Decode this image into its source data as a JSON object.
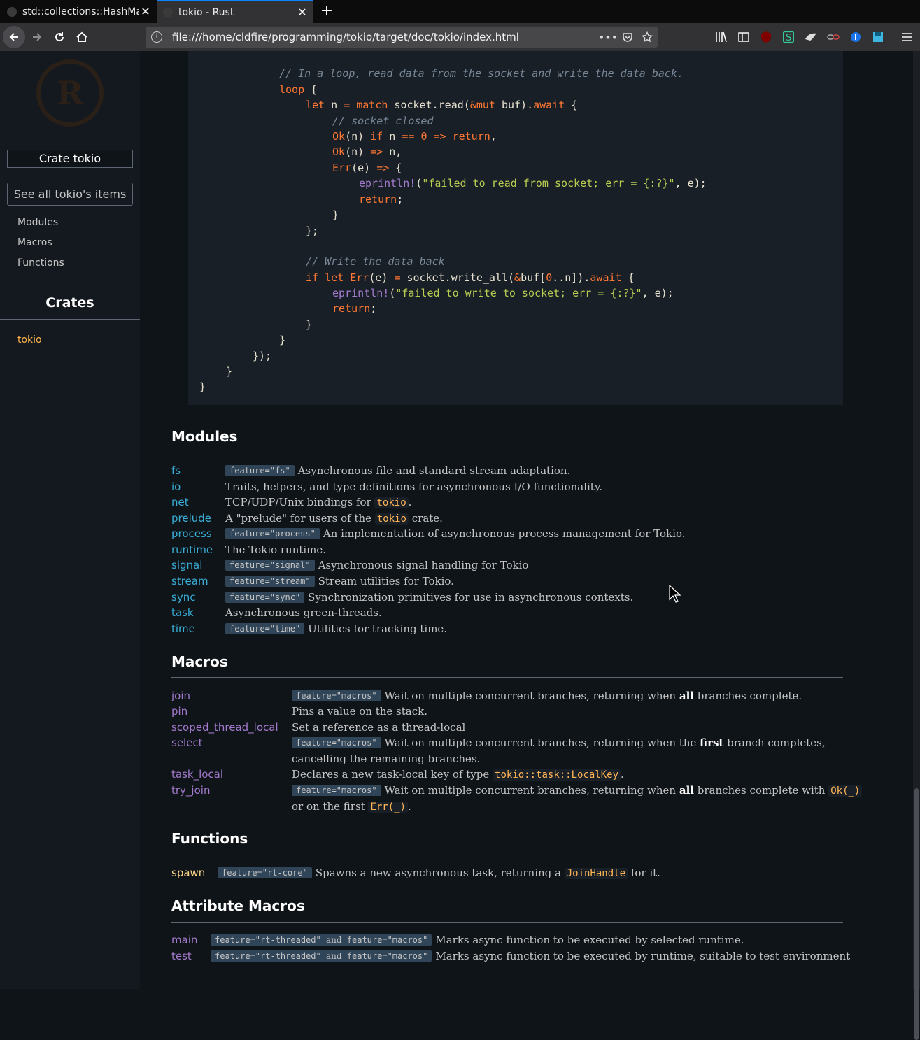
{
  "browser": {
    "tabs": [
      {
        "title": "std::collections::HashMap"
      },
      {
        "title": "tokio - Rust"
      }
    ],
    "url": "file:///home/cldfire/programming/tokio/target/doc/tokio/index.html"
  },
  "sidebar": {
    "crate_label": "Crate tokio",
    "all_items_label": "See all tokio's items",
    "links": [
      "Modules",
      "Macros",
      "Functions"
    ],
    "crates_heading": "Crates",
    "crates": [
      "tokio"
    ]
  },
  "code": {
    "lines": [
      "// In a loop, read data from the socket and write the data back.",
      "loop {",
      "let n = match socket.read(&mut buf).await {",
      "// socket closed",
      "Ok(n) if n == 0 => return,",
      "Ok(n) => n,",
      "Err(e) => {",
      "eprintln!(\"failed to read from socket; err = {:?}\", e);",
      "return;",
      "}",
      "};",
      "// Write the data back",
      "if let Err(e) = socket.write_all(&buf[0..n]).await {",
      "eprintln!(\"failed to write to socket; err = {:?}\", e);",
      "return;",
      "}",
      "}",
      "});",
      "}",
      "}"
    ]
  },
  "modules": {
    "heading": "Modules",
    "items": [
      {
        "name": "fs",
        "feature": "feature=\"fs\"",
        "desc": "Asynchronous file and standard stream adaptation."
      },
      {
        "name": "io",
        "feature": "",
        "desc": "Traits, helpers, and type definitions for asynchronous I/O functionality."
      },
      {
        "name": "net",
        "feature": "",
        "desc_pre": "TCP/UDP/Unix bindings for ",
        "desc_code": "tokio",
        "desc_post": "."
      },
      {
        "name": "prelude",
        "feature": "",
        "desc_pre": "A \"prelude\" for users of the ",
        "desc_code": "tokio",
        "desc_post": " crate."
      },
      {
        "name": "process",
        "feature": "feature=\"process\"",
        "desc": "An implementation of asynchronous process management for Tokio."
      },
      {
        "name": "runtime",
        "feature": "",
        "desc": "The Tokio runtime."
      },
      {
        "name": "signal",
        "feature": "feature=\"signal\"",
        "desc": "Asynchronous signal handling for Tokio"
      },
      {
        "name": "stream",
        "feature": "feature=\"stream\"",
        "desc": "Stream utilities for Tokio."
      },
      {
        "name": "sync",
        "feature": "feature=\"sync\"",
        "desc": "Synchronization primitives for use in asynchronous contexts."
      },
      {
        "name": "task",
        "feature": "",
        "desc": "Asynchronous green-threads."
      },
      {
        "name": "time",
        "feature": "feature=\"time\"",
        "desc": "Utilities for tracking time."
      }
    ]
  },
  "macros": {
    "heading": "Macros",
    "items": [
      {
        "name": "join",
        "feature": "feature=\"macros\"",
        "desc_pre": "Wait on multiple concurrent branches, returning when ",
        "desc_bold": "all",
        "desc_post": " branches complete."
      },
      {
        "name": "pin",
        "desc": "Pins a value on the stack."
      },
      {
        "name": "scoped_thread_local",
        "desc": "Set a reference as a thread-local"
      },
      {
        "name": "select",
        "feature": "feature=\"macros\"",
        "desc_pre": "Wait on multiple concurrent branches, returning when the ",
        "desc_bold": "first",
        "desc_post": " branch completes,",
        "desc_line2": "cancelling the remaining branches."
      },
      {
        "name": "task_local",
        "desc_pre": "Declares a new task-local key of type ",
        "desc_code": "tokio::task::LocalKey",
        "desc_post": "."
      },
      {
        "name": "try_join",
        "feature": "feature=\"macros\"",
        "desc_pre": "Wait on multiple concurrent branches, returning when ",
        "desc_bold": "all",
        "desc_post": " branches complete with ",
        "desc_code": "Ok(_)",
        "desc_line2_pre": "or on the first ",
        "desc_line2_code": "Err(_)",
        "desc_line2_post": "."
      }
    ]
  },
  "functions": {
    "heading": "Functions",
    "items": [
      {
        "name": "spawn",
        "feature": "feature=\"rt-core\"",
        "desc_pre": "Spawns a new asynchronous task, returning a ",
        "desc_code": "JoinHandle",
        "desc_post": " for it."
      }
    ]
  },
  "attribute_macros": {
    "heading": "Attribute Macros",
    "items": [
      {
        "name": "main",
        "feature_a": "feature=\"rt-threaded\"",
        "and": "and",
        "feature_b": "feature=\"macros\"",
        "desc": "Marks async function to be executed by selected runtime."
      },
      {
        "name": "test",
        "feature_a": "feature=\"rt-threaded\"",
        "and": "and",
        "feature_b": "feature=\"macros\"",
        "desc": "Marks async function to be executed by runtime, suitable to test environment"
      }
    ]
  },
  "colors": {
    "background": "#0f1419",
    "sidebar": "#14191f",
    "module_link": "#39afd7",
    "macro_link": "#a37acc",
    "fn_link": "#fdd687",
    "crate_link": "#ffb44c",
    "feature_badge": "#314559"
  },
  "icons": [
    "back-arrow-icon",
    "forward-arrow-icon",
    "reload-icon",
    "home-icon",
    "info-icon",
    "more-icon",
    "pocket-icon",
    "bookmark-star-icon",
    "library-icon",
    "sidebar-icon",
    "ublock-icon",
    "stylus-icon",
    "extension-icon",
    "link-icon",
    "password-icon",
    "save-icon",
    "menu-icon",
    "mouse-cursor-icon"
  ]
}
